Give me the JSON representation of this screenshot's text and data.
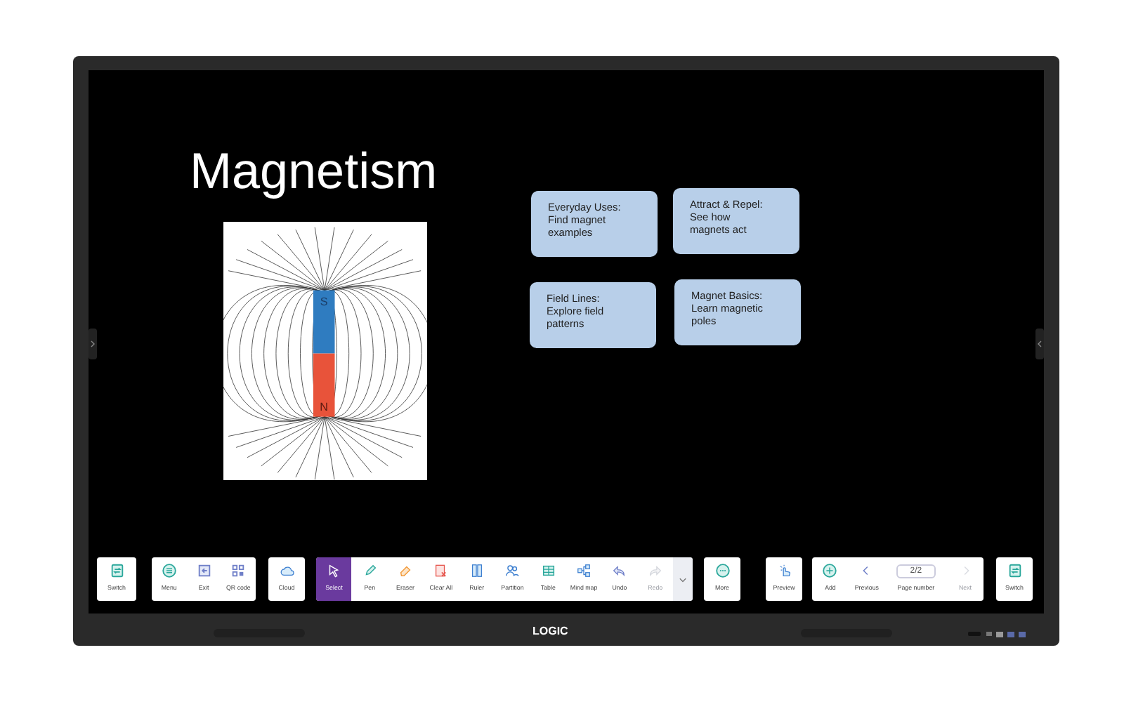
{
  "slide": {
    "title": "Magnetism",
    "magnet": {
      "south_label": "S",
      "north_label": "N"
    },
    "notes": [
      {
        "text": "Everyday Uses: Find magnet examples"
      },
      {
        "text": "Attract & Repel: See how magnets act"
      },
      {
        "text": "Field Lines: Explore field patterns"
      },
      {
        "text": "Magnet Basics: Learn magnetic poles"
      }
    ]
  },
  "toolbar": {
    "groups": [
      {
        "items": [
          {
            "kind": "tool",
            "label": "Switch",
            "selected": false,
            "disabled": false
          }
        ]
      },
      {
        "items": [
          {
            "kind": "tool",
            "label": "Menu",
            "selected": false,
            "disabled": false
          },
          {
            "kind": "tool",
            "label": "Exit",
            "selected": false,
            "disabled": false
          },
          {
            "kind": "tool",
            "label": "QR code",
            "selected": false,
            "disabled": false
          }
        ]
      },
      {
        "items": [
          {
            "kind": "tool",
            "label": "Cloud",
            "selected": false,
            "disabled": false
          }
        ]
      },
      {
        "items": [
          {
            "kind": "tool",
            "label": "Select",
            "selected": true,
            "disabled": false
          },
          {
            "kind": "tool",
            "label": "Pen",
            "selected": false,
            "disabled": false
          },
          {
            "kind": "tool",
            "label": "Eraser",
            "selected": false,
            "disabled": false
          },
          {
            "kind": "tool",
            "label": "Clear All",
            "selected": false,
            "disabled": false
          },
          {
            "kind": "tool",
            "label": "Ruler",
            "selected": false,
            "disabled": false
          },
          {
            "kind": "tool",
            "label": "Partition",
            "selected": false,
            "disabled": false
          },
          {
            "kind": "tool",
            "label": "Table",
            "selected": false,
            "disabled": false
          },
          {
            "kind": "tool",
            "label": "Mind map",
            "selected": false,
            "disabled": false
          },
          {
            "kind": "tool",
            "label": "Undo",
            "selected": false,
            "disabled": false
          },
          {
            "kind": "tool",
            "label": "Redo",
            "selected": false,
            "disabled": true
          },
          {
            "kind": "expand"
          }
        ]
      },
      {
        "items": [
          {
            "kind": "tool",
            "label": "More",
            "selected": false,
            "disabled": false
          }
        ]
      },
      {
        "items": [
          {
            "kind": "tool",
            "label": "Preview",
            "selected": false,
            "disabled": false
          }
        ]
      },
      {
        "items": [
          {
            "kind": "tool",
            "label": "Add",
            "selected": false,
            "disabled": false
          },
          {
            "kind": "tool",
            "label": "Previous",
            "selected": false,
            "disabled": false
          },
          {
            "kind": "page",
            "value": "2/2",
            "label": "Page number"
          },
          {
            "kind": "tool",
            "label": "Next",
            "selected": false,
            "disabled": true
          }
        ]
      },
      {
        "items": [
          {
            "kind": "tool",
            "label": "Switch",
            "selected": false,
            "disabled": false
          }
        ]
      }
    ]
  },
  "brand": "LOGIC"
}
